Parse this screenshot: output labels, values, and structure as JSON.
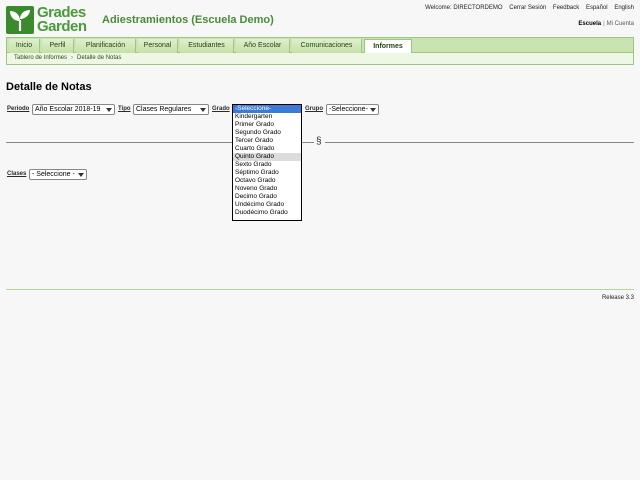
{
  "brand": {
    "logo_line1": "Grades",
    "logo_line2": "Garden"
  },
  "school_title": "Adiestramientos (Escuela Demo)",
  "toplinks": [
    "Welcome: DIRECTORDEMO",
    "Cerrar Sesión",
    "Feedback",
    "Español",
    "English"
  ],
  "userlinks": {
    "active": "Escuela",
    "sep": "|",
    "other": "Mi Cuenta"
  },
  "nav": {
    "tabs": [
      "Inicio",
      "Perfil",
      "Planificación",
      "Personal",
      "Estudiantes",
      "Año Escolar",
      "Comunicaciones",
      "Informes"
    ],
    "active_index": 7
  },
  "breadcrumb": [
    "Tablero de Informes",
    "Detalle de Notas"
  ],
  "page_title": "Detalle de Notas",
  "filters": {
    "periodo_label": "Periodo",
    "periodo_value": "Año Escolar 2018-19",
    "tipo_label": "Tipo",
    "tipo_value": "Clases Regulares",
    "grado_label": "Grado",
    "grado_value": "-Seleccione-",
    "grupo_label": "Grupo",
    "grupo_value": "-Seleccione-",
    "clases_label": "Clases",
    "clases_value": "- Seleccione -"
  },
  "section_mark": "§",
  "grado_options": [
    "-Seleccione-",
    "Kindergarten",
    "Primer Grado",
    "Segundo Grado",
    "Tercer Grado",
    "Cuarto Grado",
    "Quinto Grado",
    "Sexto Grado",
    "Séptimo Grado",
    "Octavo Grado",
    "Noveno Grado",
    "Decimo Grado",
    "Undécimo Grado",
    "Duodécimo Grado"
  ],
  "grado_selected_index": 0,
  "grado_hover_index": 6,
  "release": "Release 3.3",
  "colors": {
    "brand_green": "#3a8a2e",
    "nav_bg": "#c9e3b1",
    "selected_option": "#3a7bd5"
  }
}
